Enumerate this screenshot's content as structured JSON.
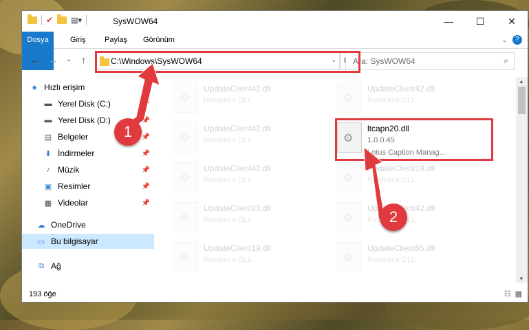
{
  "window": {
    "title": "SysWOW64",
    "controls": {
      "minimize": "—",
      "maximize": "☐",
      "close": "✕"
    }
  },
  "ribbon": {
    "tabs": [
      "Dosya",
      "Giriş",
      "Paylaş",
      "Görünüm"
    ],
    "accent": "#1979ca"
  },
  "nav": {
    "back": "←",
    "forward": "→",
    "recent": "⌄",
    "up": "↑",
    "address": "C:\\Windows\\SysWOW64",
    "search_placeholder": "Ara: SysWOW64"
  },
  "sidebar": {
    "items": [
      {
        "label": "Hızlı erişim",
        "icon": "star-icon"
      },
      {
        "label": "Yerel Disk (C:)",
        "icon": "drive-icon",
        "pinned": true
      },
      {
        "label": "Yerel Disk (D:)",
        "icon": "drive-icon",
        "pinned": true
      },
      {
        "label": "Belgeler",
        "icon": "documents-icon",
        "pinned": true
      },
      {
        "label": "İndirmeler",
        "icon": "downloads-icon",
        "pinned": true
      },
      {
        "label": "Müzik",
        "icon": "music-icon",
        "pinned": true
      },
      {
        "label": "Resimler",
        "icon": "pictures-icon",
        "pinned": true
      },
      {
        "label": "Videolar",
        "icon": "videos-icon",
        "pinned": true
      },
      {
        "label": "OneDrive",
        "icon": "cloud-icon"
      },
      {
        "label": "Bu bilgisayar",
        "icon": "computer-icon",
        "selected": true
      },
      {
        "label": "Ağ",
        "icon": "network-icon"
      }
    ]
  },
  "files": [
    {
      "name": "UpdateClient42.dll",
      "desc": "Resource DLL"
    },
    {
      "name": "UpdateClient42.dll",
      "desc": "Resource DLL"
    },
    {
      "name": "UpdateClient42.dll",
      "desc": "Resource DLL"
    },
    {
      "name": "ltcapn20.dll",
      "desc": "1.0.0.45",
      "extra": "Lotus Caption Manag...",
      "highlighted": true
    },
    {
      "name": "UpdateClient42.dll",
      "desc": "Resource DLL"
    },
    {
      "name": "UpdateClient19.dll",
      "desc": "Resource DLL"
    },
    {
      "name": "UpdateClient21.dll",
      "desc": "Resource DLL"
    },
    {
      "name": "UpdateClient42.dll",
      "desc": "Resource DLL"
    },
    {
      "name": "UpdateClient19.dll",
      "desc": "Resource DLL"
    },
    {
      "name": "UpdateClient65.dll",
      "desc": "Resource DLL"
    }
  ],
  "status": {
    "count": "193 öğe"
  },
  "annotations": {
    "step1": "1",
    "step2": "2",
    "color": "#e03a3e"
  }
}
